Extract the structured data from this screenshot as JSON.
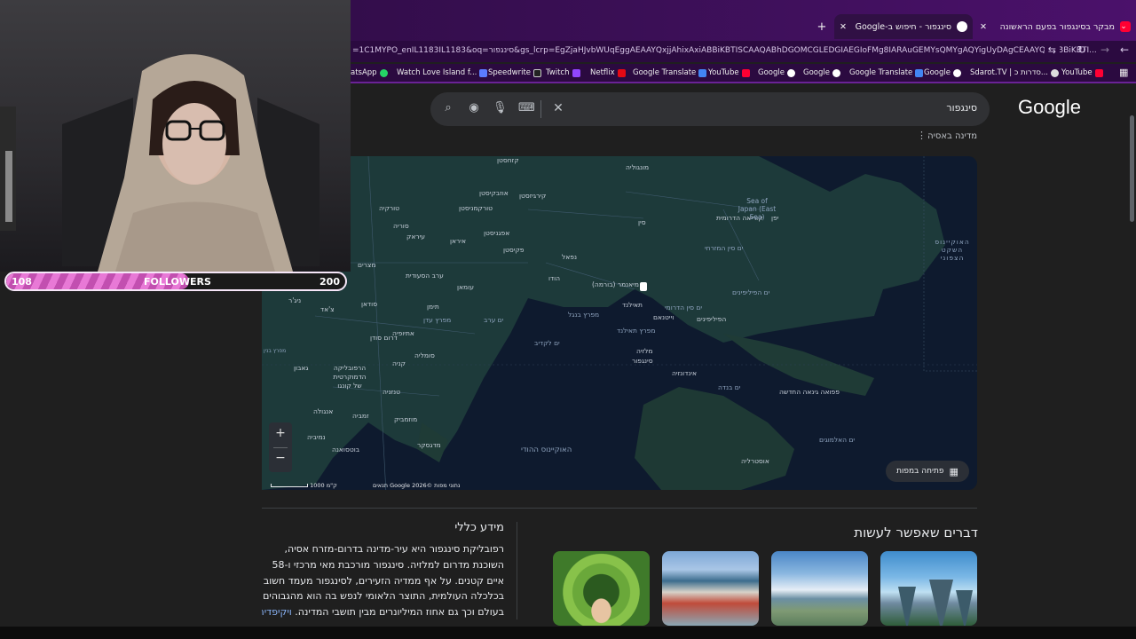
{
  "browser": {
    "tabs": [
      {
        "title": "מבקר בסינגפור בפעם הראשונה",
        "active": false
      },
      {
        "title": "סינגפור - חיפוש ב-Google",
        "active": true
      }
    ],
    "url": "=1C1MYPO_enIL1183IL1183&oq=סינגפור&gs_lcrp=EgZjaHJvbWUqEggAEAAYQxjjAhixAxiABBiKBTISCAAQABhDGOMCGLEDGIAEGIoFMg8IARAuGEMYsQMYgAQYigUyDAgCEAAYQxiABBiKBTI...",
    "bookmarks": [
      "atsApp",
      "Watch Love Island f...",
      "Speedwrite",
      "Twitch",
      "Netflix",
      "Google Translate",
      "YouTube",
      "Google",
      "Google",
      "Google Translate",
      "Google",
      "Sdarot.TV | סדרות כ...",
      "YouTube"
    ]
  },
  "search": {
    "query": "סינגפור"
  },
  "google_logo": "Google",
  "knowledge_panel": {
    "subtitle": "מדינה באסיה",
    "map_labels": {
      "countries": [
        "קזחסטן",
        "מונגוליה",
        "אוזבקיסטן",
        "קירגיזסטן",
        "טורקמניסטן",
        "טורקיה",
        "סוריה",
        "עיראק",
        "איראן",
        "אפגניסטן",
        "פקיסטן",
        "סין",
        "קוריאה הדרומית",
        "יפן",
        "נפאל",
        "הודו",
        "מיאנמר (בורמה)",
        "תאילנד",
        "וייטנאם",
        "הפיליפינים",
        "מלזיה",
        "סינגפור",
        "אינדונזיה",
        "פפואה גינאה החדשה",
        "אוסטרליה",
        "ערב הסעודית",
        "עומאן",
        "תימן",
        "מצרים",
        "סודאן",
        "צ'אד",
        "ניג'ר",
        "אתיופיה",
        "דרום סודן",
        "סומליה",
        "קניה",
        "הרפובליקה הדמוקרטית של קונגו",
        "טנזניה",
        "אנגולה",
        "זמביה",
        "מוזמביק",
        "נמיביה",
        "בוטסואנה",
        "מדגסקר",
        "גאבון"
      ],
      "seas": [
        "Sea of Japan (East Sea)",
        "ים סין המזרחי",
        "ים הפיליפינים",
        "ים סין הדרומי",
        "מפרץ בנגל",
        "ים ערב",
        "ים לקדיב",
        "האוקיינוס ההודי",
        "מפרץ תאילנד",
        "ים בנדה",
        "ים האלמוגים",
        "מפרץ עדן",
        "מפרץ בנין",
        "האוקיינוס השקט הצפוני"
      ]
    },
    "open_map_label": "פתיחה במפות",
    "map_footer": "נתוני מפות ©2026 Google  תנאים",
    "map_scale": "1000 ק\"מ",
    "zoom_in": "+",
    "zoom_out": "−",
    "info_heading": "מידע כללי",
    "info_body": "רפובליקת סינגפור היא עיר-מדינה בדרום-מזרח אסיה, השוכנת מדרום למלזיה. סינגפור מורכבת מאי מרכזי ו-58 איים קטנים. על אף ממדיה הזעירים, לסינגפור מעמד חשוב בכלכלה העולמית, התוצר הלאומי לנפש בה הוא מהגבוהים בעולם וכך גם אחוז המיליונרים מבין תושבי המדינה.",
    "info_link": "ויקיפדיה",
    "things_to_do_heading": "דברים שאפשר לעשות"
  },
  "overlay": {
    "followers_label": "FOLLOWERS",
    "followers_current": "108",
    "followers_goal": "200",
    "progress_fraction": 0.54
  },
  "colors": {
    "accent_pink": "#e879d6",
    "tabbar_purple": "#3a0f55",
    "link_blue": "#8ab4f8"
  }
}
